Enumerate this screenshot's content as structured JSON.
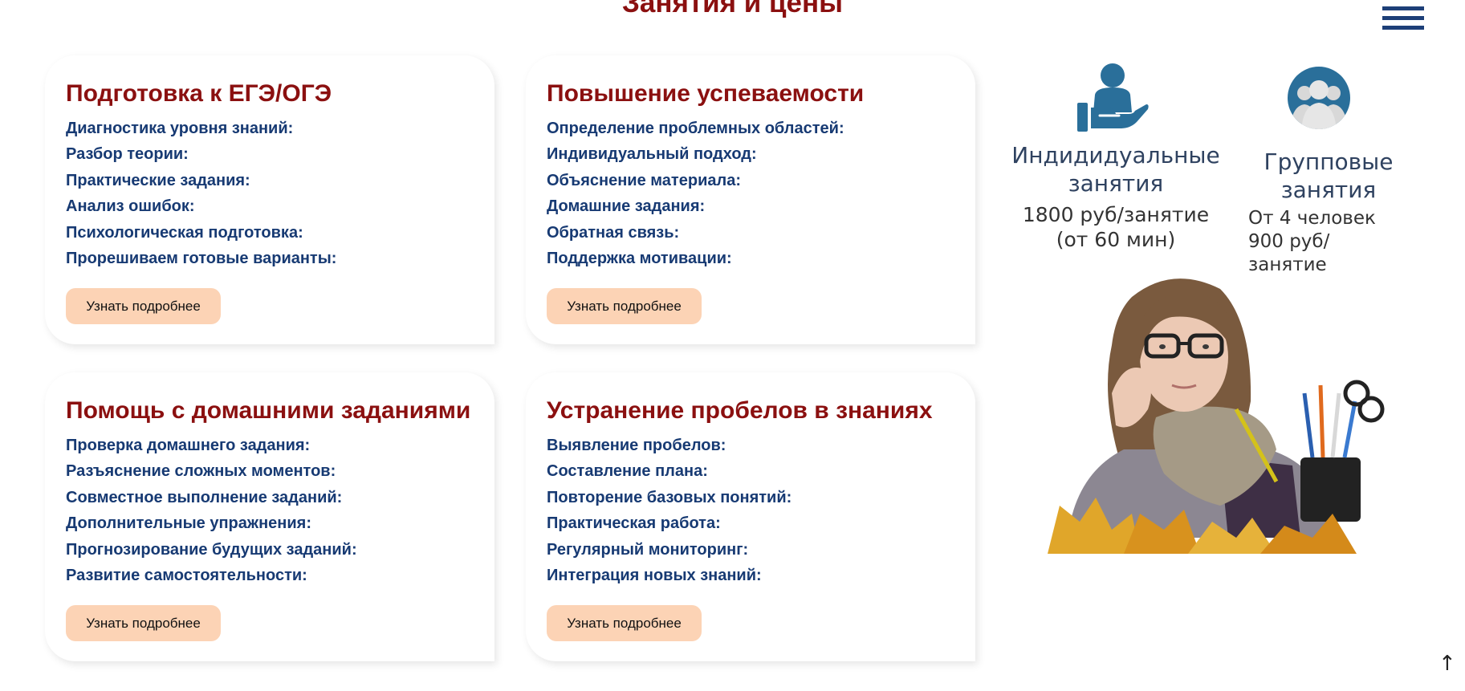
{
  "header": {
    "title": "Занятия и цены"
  },
  "cards": [
    {
      "title": "Подготовка к ЕГЭ/ОГЭ",
      "items": [
        "Диагностика уровня знаний:",
        "Разбор теории:",
        "Практические задания:",
        "Анализ ошибок:",
        "Психологическая подготовка:",
        "Прорешиваем готовые варианты:"
      ],
      "button": "Узнать подробнее"
    },
    {
      "title": "Повышение успеваемости",
      "items": [
        "Определение проблемных областей:",
        "Индивидуальный подход:",
        "Объяснение материала:",
        "Домашние задания:",
        "Обратная связь:",
        "Поддержка мотивации:"
      ],
      "button": "Узнать подробнее"
    },
    {
      "title": "Помощь с домашними заданиями",
      "items": [
        "Проверка домашнего задания:",
        "Разъяснение сложных моментов:",
        "Совместное выполнение заданий:",
        "Дополнительные упражнения:",
        "Прогнозирование будущих заданий:",
        "Развитие самостоятельности:"
      ],
      "button": "Узнать подробнее"
    },
    {
      "title": "Устранение пробелов в знаниях",
      "items": [
        "Выявление пробелов:",
        "Составление плана:",
        "Повторение базовых понятий:",
        "Практическая работа:",
        "Регулярный мониторинг:",
        "Интеграция новых знаний:"
      ],
      "button": "Узнать подробнее"
    }
  ],
  "pricing": {
    "individual": {
      "title_line1": "Индидидуальные",
      "title_line2": "занятия",
      "price": "1800 руб/занятие",
      "duration": "(от 60 мин)"
    },
    "group": {
      "title_line1": "Групповые",
      "title_line2": "занятия",
      "size": "От 4 человек",
      "price": "900 руб/ занятие"
    }
  },
  "icons": {
    "menu": "hamburger-menu-icon",
    "individual": "person-on-hand-icon",
    "group": "group-people-icon",
    "scroll_top": "arrow-up-icon"
  },
  "colors": {
    "title": "#8b1010",
    "item_text": "#173a73",
    "button_bg": "#fcd3b5",
    "icon": "#2a6f9a",
    "menu": "#1d3f78"
  },
  "scroll_top_glyph": "↑"
}
